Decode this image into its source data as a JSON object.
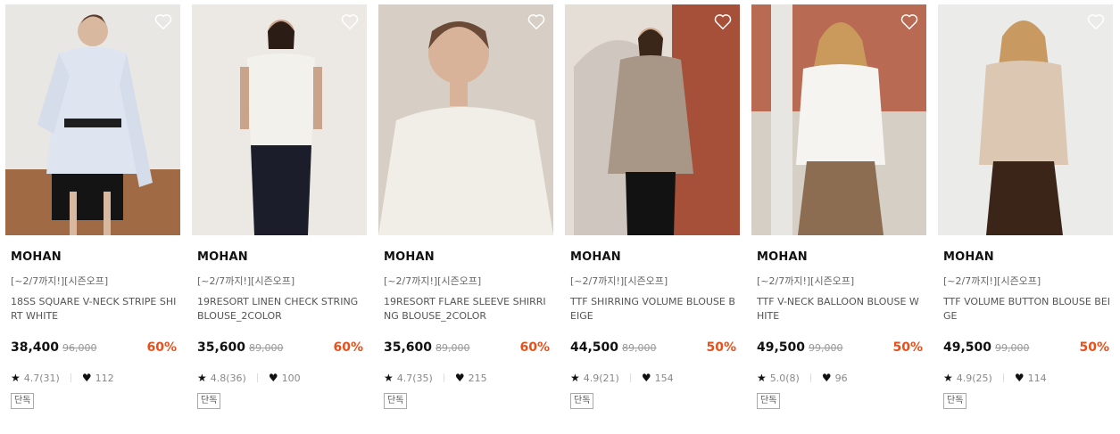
{
  "colors": {
    "discount": "#e8501b",
    "heart_outline": "#ffffff",
    "text_main": "#111111",
    "text_sub": "#666666"
  },
  "icons": {
    "wishlist": "heart-outline-icon",
    "rating": "star-icon",
    "likes": "heart-filled-icon"
  },
  "products": [
    {
      "brand": "MOHAN",
      "promo": "[~2/7까지!][시즌오프]",
      "name": "18SS SQUARE V-NECK STRIPE SHIRT WHITE",
      "price": "38,400",
      "original_price": "96,000",
      "discount": "60%",
      "rating": "4.7(31)",
      "likes": "112",
      "tag": "단독"
    },
    {
      "brand": "MOHAN",
      "promo": "[~2/7까지!][시즌오프]",
      "name": "19RESORT LINEN CHECK STRING BLOUSE_2COLOR",
      "price": "35,600",
      "original_price": "89,000",
      "discount": "60%",
      "rating": "4.8(36)",
      "likes": "100",
      "tag": "단독"
    },
    {
      "brand": "MOHAN",
      "promo": "[~2/7까지!][시즌오프]",
      "name": "19RESORT FLARE SLEEVE SHIRRING BLOUSE_2COLOR",
      "price": "35,600",
      "original_price": "89,000",
      "discount": "60%",
      "rating": "4.7(35)",
      "likes": "215",
      "tag": "단독"
    },
    {
      "brand": "MOHAN",
      "promo": "[~2/7까지!][시즌오프]",
      "name": "TTF SHIRRING VOLUME BLOUSE BEIGE",
      "price": "44,500",
      "original_price": "89,000",
      "discount": "50%",
      "rating": "4.9(21)",
      "likes": "154",
      "tag": "단독"
    },
    {
      "brand": "MOHAN",
      "promo": "[~2/7까지!][시즌오프]",
      "name": "TTF V-NECK BALLOON BLOUSE WHITE",
      "price": "49,500",
      "original_price": "99,000",
      "discount": "50%",
      "rating": "5.0(8)",
      "likes": "96",
      "tag": "단독"
    },
    {
      "brand": "MOHAN",
      "promo": "[~2/7까지!][시즌오프]",
      "name": "TTF VOLUME BUTTON BLOUSE BEIGE",
      "price": "49,500",
      "original_price": "99,000",
      "discount": "50%",
      "rating": "4.9(25)",
      "likes": "114",
      "tag": "단독"
    }
  ]
}
